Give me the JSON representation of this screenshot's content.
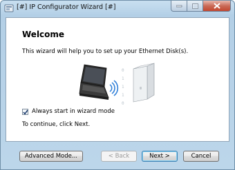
{
  "window": {
    "title": "[#] IP Configurator Wizard [#]"
  },
  "page": {
    "heading": "Welcome",
    "intro": "This wizard will help you to set up your Ethernet Disk(s).",
    "checkbox_label": "Always start in wizard mode",
    "checkbox_checked": true,
    "continue_text": "To continue, click Next.",
    "binary_digits": [
      "0",
      "1",
      "1",
      "1",
      "0"
    ]
  },
  "buttons": {
    "advanced": "Advanced Mode...",
    "back": "< Back",
    "next": "Next >",
    "cancel": "Cancel"
  },
  "colors": {
    "accent": "#3c7fb1",
    "wifi": "#2f7fd8",
    "close": "#c3452d"
  },
  "icons": {
    "app": "wizard-app-icon",
    "laptop": "laptop-icon",
    "wireless": "wireless-signal-icon",
    "disk": "ethernet-disk-icon"
  }
}
